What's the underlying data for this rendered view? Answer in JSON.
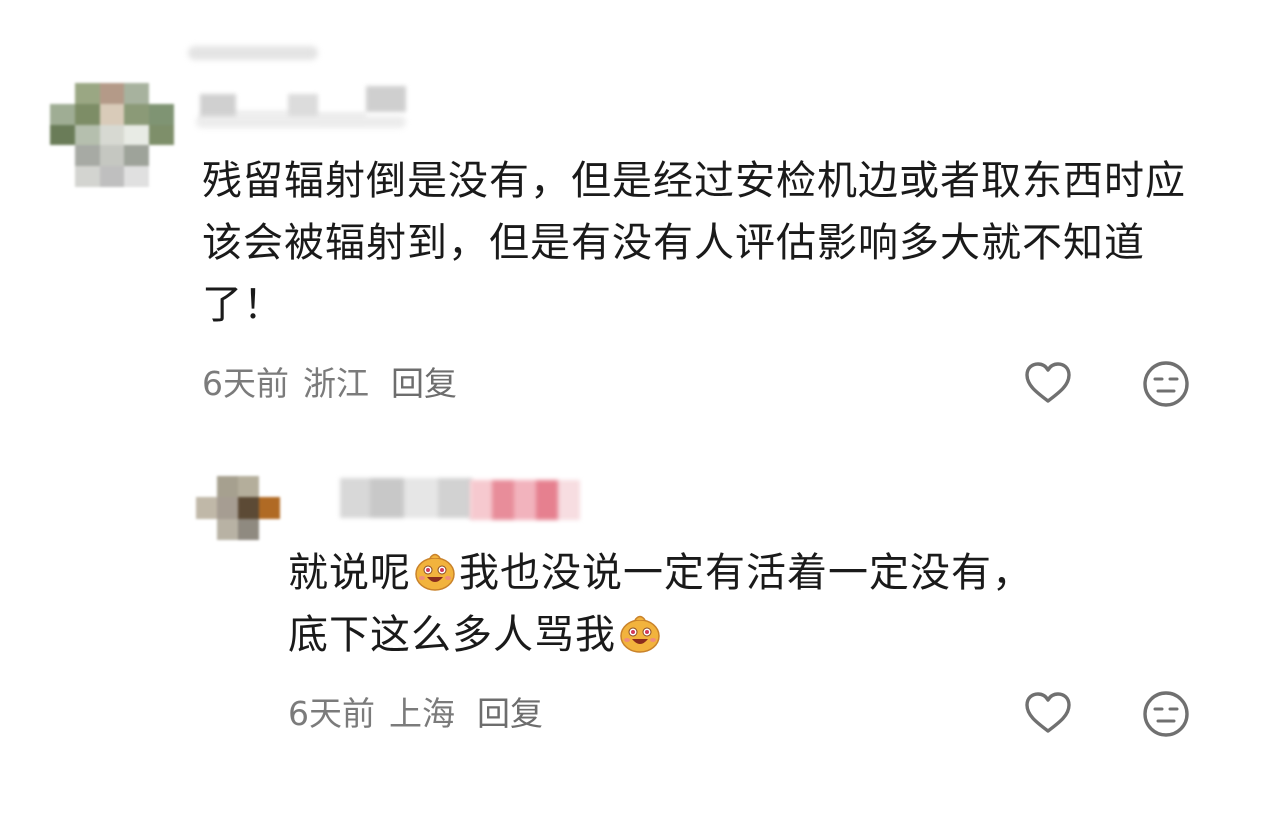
{
  "comments": [
    {
      "text": "残留辐射倒是没有，但是经过安检机边或者取东西时应该会被辐射到，但是有没有人评估影响多大就不知道了！",
      "time": "6天前",
      "location": "浙江",
      "reply_label": "回复",
      "like_icon": "heart-outline-icon",
      "dislike_icon": "neutral-face-icon"
    },
    {
      "text_part1": "就说呢",
      "text_part2": "我也没说一定有活着一定没有，",
      "text_part3": "底下这么多人骂我",
      "emoji_icon": "grinning-bun-emoji-icon",
      "time": "6天前",
      "location": "上海",
      "reply_label": "回复",
      "like_icon": "heart-outline-icon",
      "dislike_icon": "neutral-face-icon"
    }
  ],
  "colors": {
    "text": "#1a1a1a",
    "meta": "#7b7b7b",
    "icon": "#707070"
  }
}
